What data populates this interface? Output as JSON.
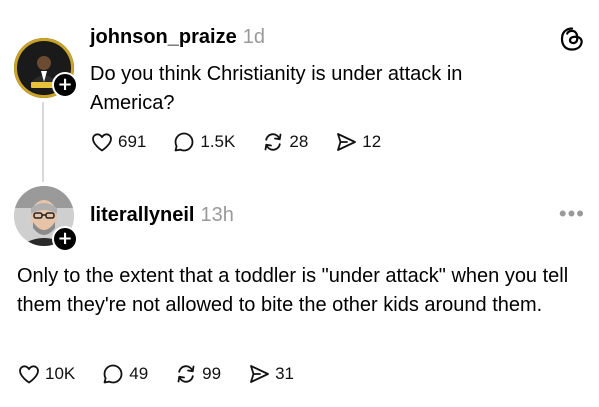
{
  "posts": [
    {
      "username": "johnson_praize",
      "time": "1d",
      "text": "Do you think Christianity is under attack in America?",
      "likes": "691",
      "replies": "1.5K",
      "reposts": "28",
      "shares": "12"
    },
    {
      "username": "literallyneil",
      "time": "13h",
      "text": "Only to the extent that a toddler is \"under attack\" when you tell them they're not allowed to bite the other kids around them.",
      "likes": "10K",
      "replies": "49",
      "reposts": "99",
      "shares": "31"
    }
  ],
  "icons": {
    "like": "heart-icon",
    "reply": "comment-bubble-icon",
    "repost": "repost-icon",
    "share": "share-send-icon",
    "logo": "threads-logo-icon",
    "more": "more-dots-icon",
    "follow": "plus-icon"
  },
  "colors": {
    "text": "#000000",
    "muted": "#999999",
    "thread_line": "#d9d9d9"
  }
}
